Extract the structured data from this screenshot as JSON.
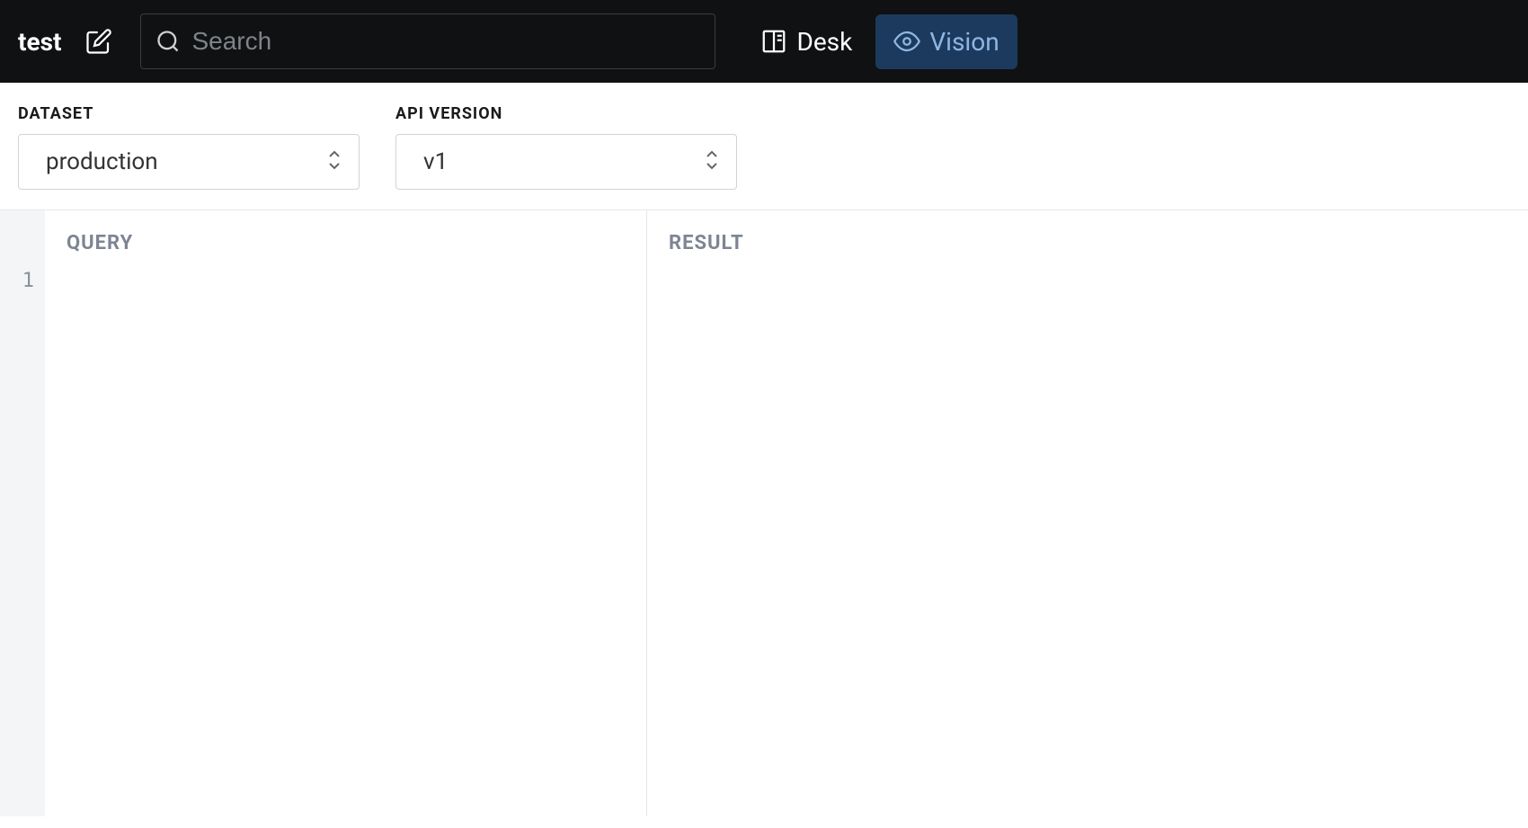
{
  "header": {
    "logo": "test",
    "search_placeholder": "Search",
    "nav": {
      "desk": "Desk",
      "vision": "Vision"
    }
  },
  "controls": {
    "dataset": {
      "label": "DATASET",
      "value": "production"
    },
    "api_version": {
      "label": "API VERSION",
      "value": "v1"
    }
  },
  "panels": {
    "query": {
      "heading": "QUERY",
      "line_number": "1"
    },
    "result": {
      "heading": "RESULT"
    }
  }
}
